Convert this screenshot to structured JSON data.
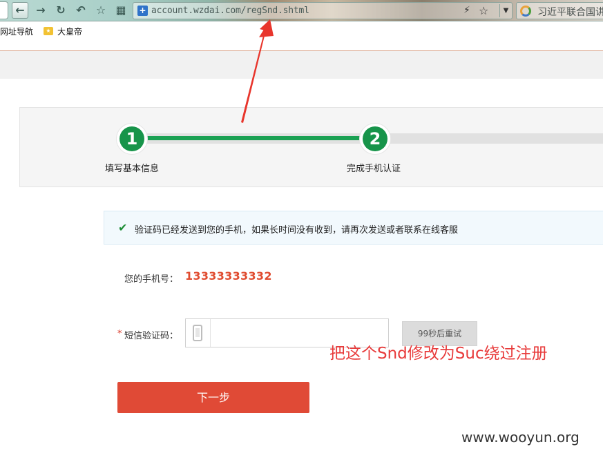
{
  "browser": {
    "url": "account.wzdai.com/regSnd.shtml",
    "search_text": "习近平联合国讲",
    "bookmarks": [
      "网址导航",
      "大皇帝"
    ]
  },
  "steps": [
    {
      "number": "1",
      "label": "填写基本信息"
    },
    {
      "number": "2",
      "label": "完成手机认证"
    }
  ],
  "notice": {
    "text": "验证码已经发送到您的手机，如果长时间没有收到，请再次发送或者联系在线客服"
  },
  "form": {
    "phone_label": "您的手机号：",
    "phone_value": "13333333332",
    "code_label": "短信验证码：",
    "required_mark": "*",
    "code_value": "",
    "retry_button": "99秒后重试",
    "next_button": "下一步"
  },
  "annotation": "把这个Snd修改为Suc绕过注册",
  "watermark": "www.wooyun.org",
  "colors": {
    "accent_green": "#17944a",
    "next_button": "#e04a36",
    "phone_value": "#e04b2f",
    "annotation": "#e83b3b"
  }
}
